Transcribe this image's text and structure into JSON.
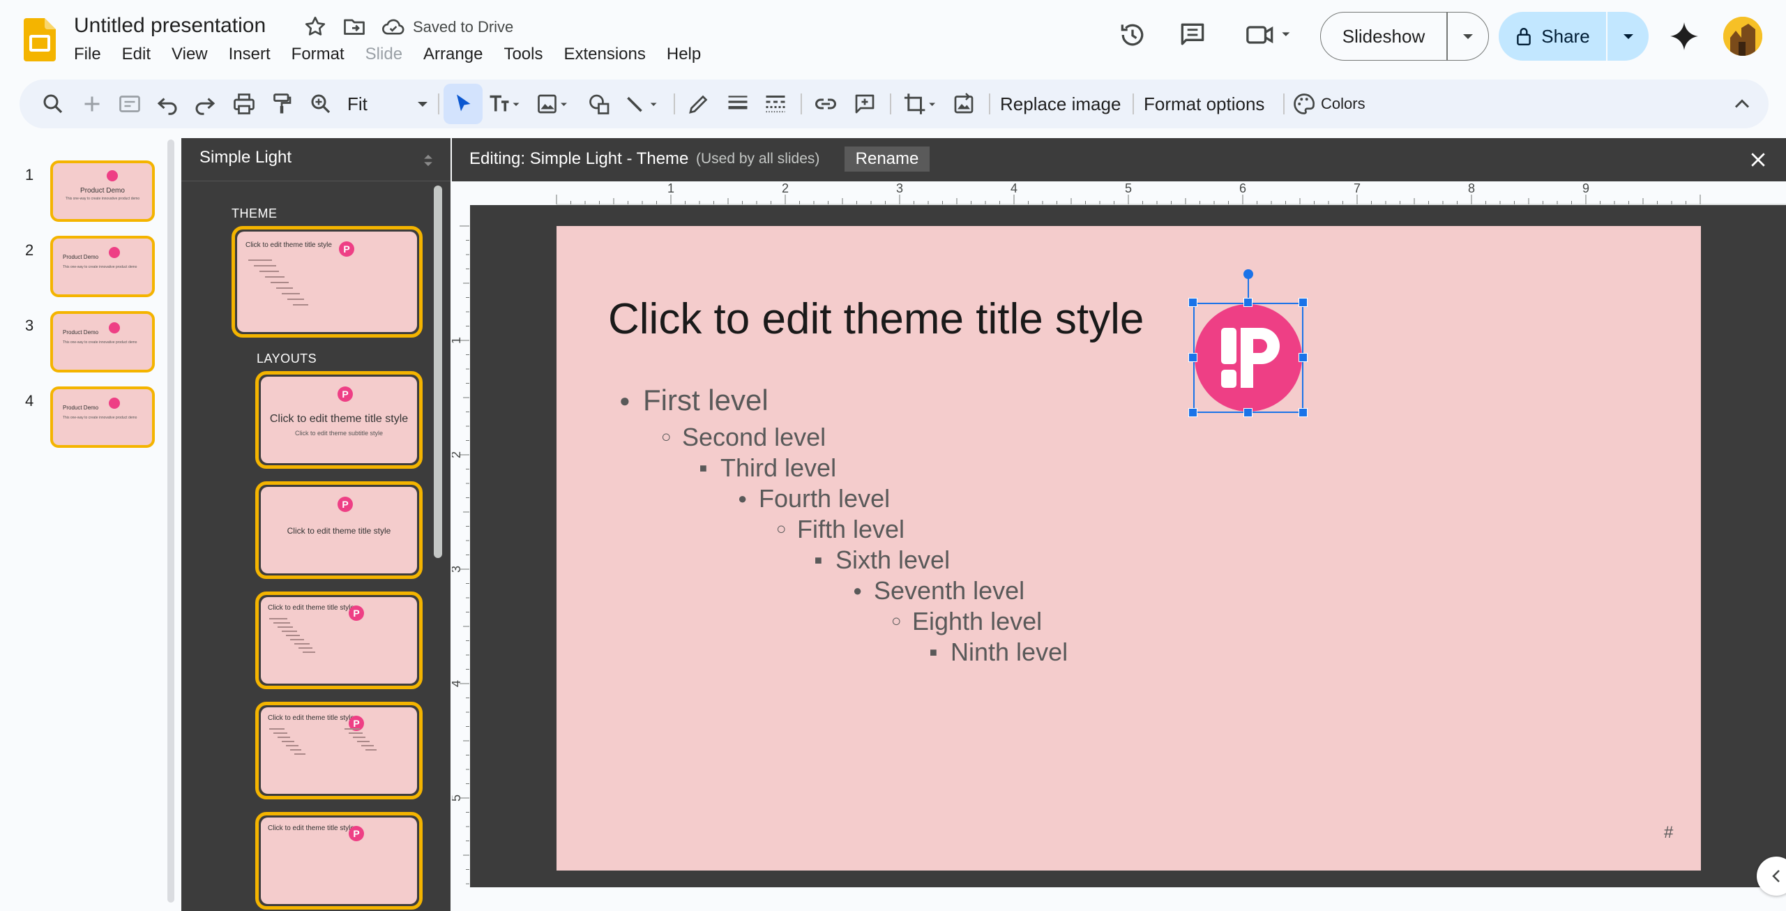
{
  "header": {
    "title": "Untitled presentation",
    "save_status": "Saved to Drive",
    "menus": [
      "File",
      "Edit",
      "View",
      "Insert",
      "Format",
      "Slide",
      "Arrange",
      "Tools",
      "Extensions",
      "Help"
    ],
    "slideshow_label": "Slideshow",
    "share_label": "Share"
  },
  "toolbar": {
    "zoom_value": "Fit",
    "replace_image": "Replace image",
    "format_options": "Format options",
    "colors": "Colors"
  },
  "filmstrip": {
    "slides": [
      {
        "num": "1",
        "title": "Product Demo",
        "subtitle": "This one-way to create innovative product demo"
      },
      {
        "num": "2",
        "title": "Product Demo",
        "subtitle": "This one-way to create innovative product demo"
      },
      {
        "num": "3",
        "title": "Product Demo",
        "subtitle": "This one-way to create innovative product demo"
      },
      {
        "num": "4",
        "title": "Product Demo",
        "subtitle": "This one-way to create innovative product demo"
      }
    ]
  },
  "theme_panel": {
    "theme_name": "Simple Light",
    "theme_label": "THEME",
    "layouts_label": "LAYOUTS",
    "theme_thumb_title": "Click to edit theme title style",
    "layout1_title": "Click to edit theme title style",
    "layout1_subtitle": "Click to edit theme subtitle style",
    "layout2_title": "Click to edit theme title style",
    "layout3_title": "Click to edit theme title style",
    "layout4_title": "Click to edit theme title style",
    "layout5_title": "Click to edit theme title style",
    "logo_letter": "P"
  },
  "editing": {
    "title": "Editing: Simple Light - Theme",
    "subtitle": "(Used by all slides)",
    "rename_label": "Rename"
  },
  "ruler": {
    "h_labels": [
      "1",
      "2",
      "3",
      "4",
      "5",
      "6",
      "7",
      "8",
      "9"
    ],
    "v_labels": [
      "1",
      "2",
      "3",
      "4",
      "5"
    ]
  },
  "slide": {
    "title": "Click to edit theme title style",
    "levels": [
      {
        "marker": "●",
        "text": "First level"
      },
      {
        "marker": "○",
        "text": "Second level"
      },
      {
        "marker": "■",
        "text": "Third level"
      },
      {
        "marker": "●",
        "text": "Fourth level"
      },
      {
        "marker": "○",
        "text": "Fifth level"
      },
      {
        "marker": "■",
        "text": "Sixth level"
      },
      {
        "marker": "●",
        "text": "Seventh level"
      },
      {
        "marker": "○",
        "text": "Eighth level"
      },
      {
        "marker": "■",
        "text": "Ninth level"
      }
    ],
    "slide_number": "#"
  },
  "colors": {
    "slide_bg": "#f4cccc",
    "logo_pink": "#ee3f85",
    "selection_blue": "#1a73e8",
    "thumb_border": "#f4b400",
    "share_bg": "#c2e7ff"
  },
  "icons": [
    "slides-logo",
    "star-icon",
    "move-to-folder-icon",
    "cloud-check-icon",
    "history-icon",
    "comment-icon",
    "meet-icon",
    "lock-icon",
    "gemini-icon",
    "search-icon",
    "new-slide-icon",
    "undo-icon",
    "redo-icon",
    "print-icon",
    "paint-format-icon",
    "zoom-icon",
    "select-icon",
    "text-box-icon",
    "image-icon",
    "shape-icon",
    "line-icon",
    "pen-icon",
    "border-weight-icon",
    "border-dash-icon",
    "link-icon",
    "add-comment-icon",
    "crop-icon",
    "reset-image-icon",
    "palette-icon",
    "collapse-icon",
    "close-icon"
  ]
}
